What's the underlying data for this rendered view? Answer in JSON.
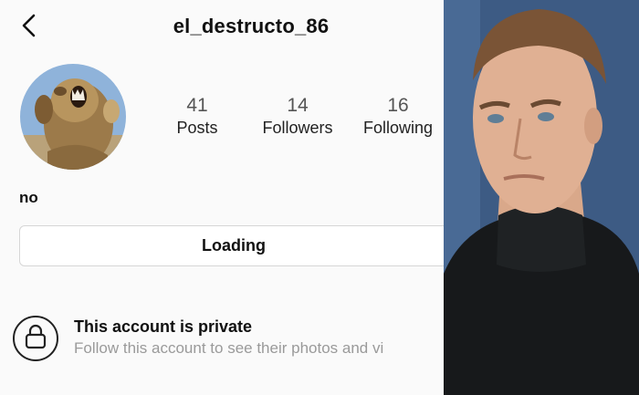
{
  "profile": {
    "username": "el_destructo_86",
    "bio": "no"
  },
  "stats": [
    {
      "value": "41",
      "label": "Posts"
    },
    {
      "value": "14",
      "label": "Followers"
    },
    {
      "value": "16",
      "label": "Following"
    }
  ],
  "action_button": {
    "label": "Loading"
  },
  "private_notice": {
    "title": "This account is private",
    "subtitle": "Follow this account to see their photos and vi"
  },
  "icons": {
    "back": "chevron-left-icon",
    "lock": "lock-icon"
  },
  "colors": {
    "app_background": "#fafafa",
    "text_primary": "#111111",
    "text_secondary": "#9a9a9a",
    "button_border": "#d6d6d6"
  }
}
